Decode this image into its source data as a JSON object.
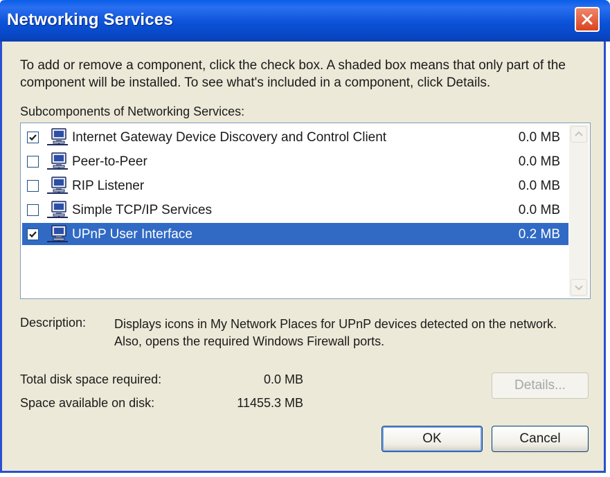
{
  "window": {
    "title": "Networking Services",
    "close_icon": "close-x-icon"
  },
  "intro_text": "To add or remove a component, click the check box. A shaded box means that only part of the component will be installed. To see what's included in a component, click Details.",
  "subcomponents_label": "Subcomponents of Networking Services:",
  "components": [
    {
      "name": "Internet Gateway Device Discovery and Control Client",
      "size": "0.0 MB",
      "checked": true,
      "selected": false,
      "icon": "network-computer-icon"
    },
    {
      "name": "Peer-to-Peer",
      "size": "0.0 MB",
      "checked": false,
      "selected": false,
      "icon": "network-computer-icon"
    },
    {
      "name": "RIP Listener",
      "size": "0.0 MB",
      "checked": false,
      "selected": false,
      "icon": "network-computer-icon"
    },
    {
      "name": "Simple TCP/IP Services",
      "size": "0.0 MB",
      "checked": false,
      "selected": false,
      "icon": "network-computer-icon"
    },
    {
      "name": "UPnP User Interface",
      "size": "0.2 MB",
      "checked": true,
      "selected": true,
      "icon": "network-computer-icon"
    }
  ],
  "description": {
    "label": "Description:",
    "text": "Displays icons in My Network Places for UPnP devices detected on the network. Also, opens the required Windows Firewall ports."
  },
  "disk": {
    "required_label": "Total disk space required:",
    "required_value": "0.0 MB",
    "available_label": "Space available on disk:",
    "available_value": "11455.3 MB"
  },
  "buttons": {
    "details": "Details...",
    "ok": "OK",
    "cancel": "Cancel"
  },
  "colors": {
    "titlebar": "#0a52d8",
    "selection": "#316ac5",
    "dialog_bg": "#ece9d8",
    "close_button": "#d9441f"
  }
}
